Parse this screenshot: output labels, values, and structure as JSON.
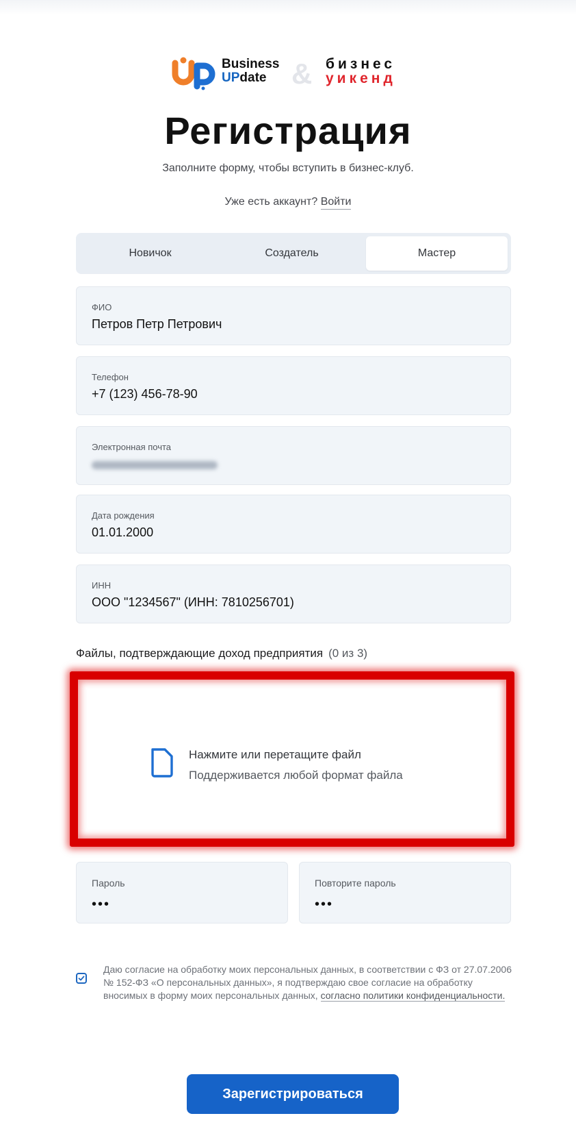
{
  "logo": {
    "business_line1": "Business",
    "business_line2_up": "UP",
    "business_line2_rest": "date",
    "ampersand": "&",
    "weekend_line1": "бизнес",
    "weekend_line2": "уикенд"
  },
  "header": {
    "title": "Регистрация",
    "subtitle": "Заполните форму, чтобы вступить в бизнес-клуб.",
    "login_prompt": "Уже есть аккаунт?",
    "login_link": "Войти"
  },
  "tabs": [
    {
      "label": "Новичок",
      "active": false
    },
    {
      "label": "Создатель",
      "active": false
    },
    {
      "label": "Мастер",
      "active": true
    }
  ],
  "fields": {
    "fio": {
      "label": "ФИО",
      "value": "Петров Петр Петрович"
    },
    "phone": {
      "label": "Телефон",
      "value": "+7 (123) 456-78-90"
    },
    "email": {
      "label": "Электронная почта"
    },
    "birthdate": {
      "label": "Дата рождения",
      "value": "01.01.2000"
    },
    "inn": {
      "label": "ИНН",
      "value": "ООО \"1234567\" (ИНН: 7810256701)"
    }
  },
  "files": {
    "label": "Файлы, подтверждающие доход предприятия",
    "count": "(0 из 3)",
    "drop_title": "Нажмите или перетащите файл",
    "drop_hint": "Поддерживается любой формат файла"
  },
  "password": {
    "label": "Пароль",
    "value": "•••"
  },
  "password_repeat": {
    "label": "Повторите пароль",
    "value": "•••"
  },
  "consent": {
    "checked": true,
    "text": "Даю согласие на обработку моих персональных данных, в соответствии с ФЗ от 27.07.2006 № 152-ФЗ «О персональных данных», я подтверждаю свое согласие на обработку вносимых в форму моих персональных данных,",
    "link": "согласно политики конфиденциальности."
  },
  "submit_label": "Зарегистрироваться",
  "colors": {
    "accent": "#1663c8",
    "brand_red": "#e0262d",
    "highlight": "#d90000",
    "field_bg": "#f1f5f9"
  }
}
